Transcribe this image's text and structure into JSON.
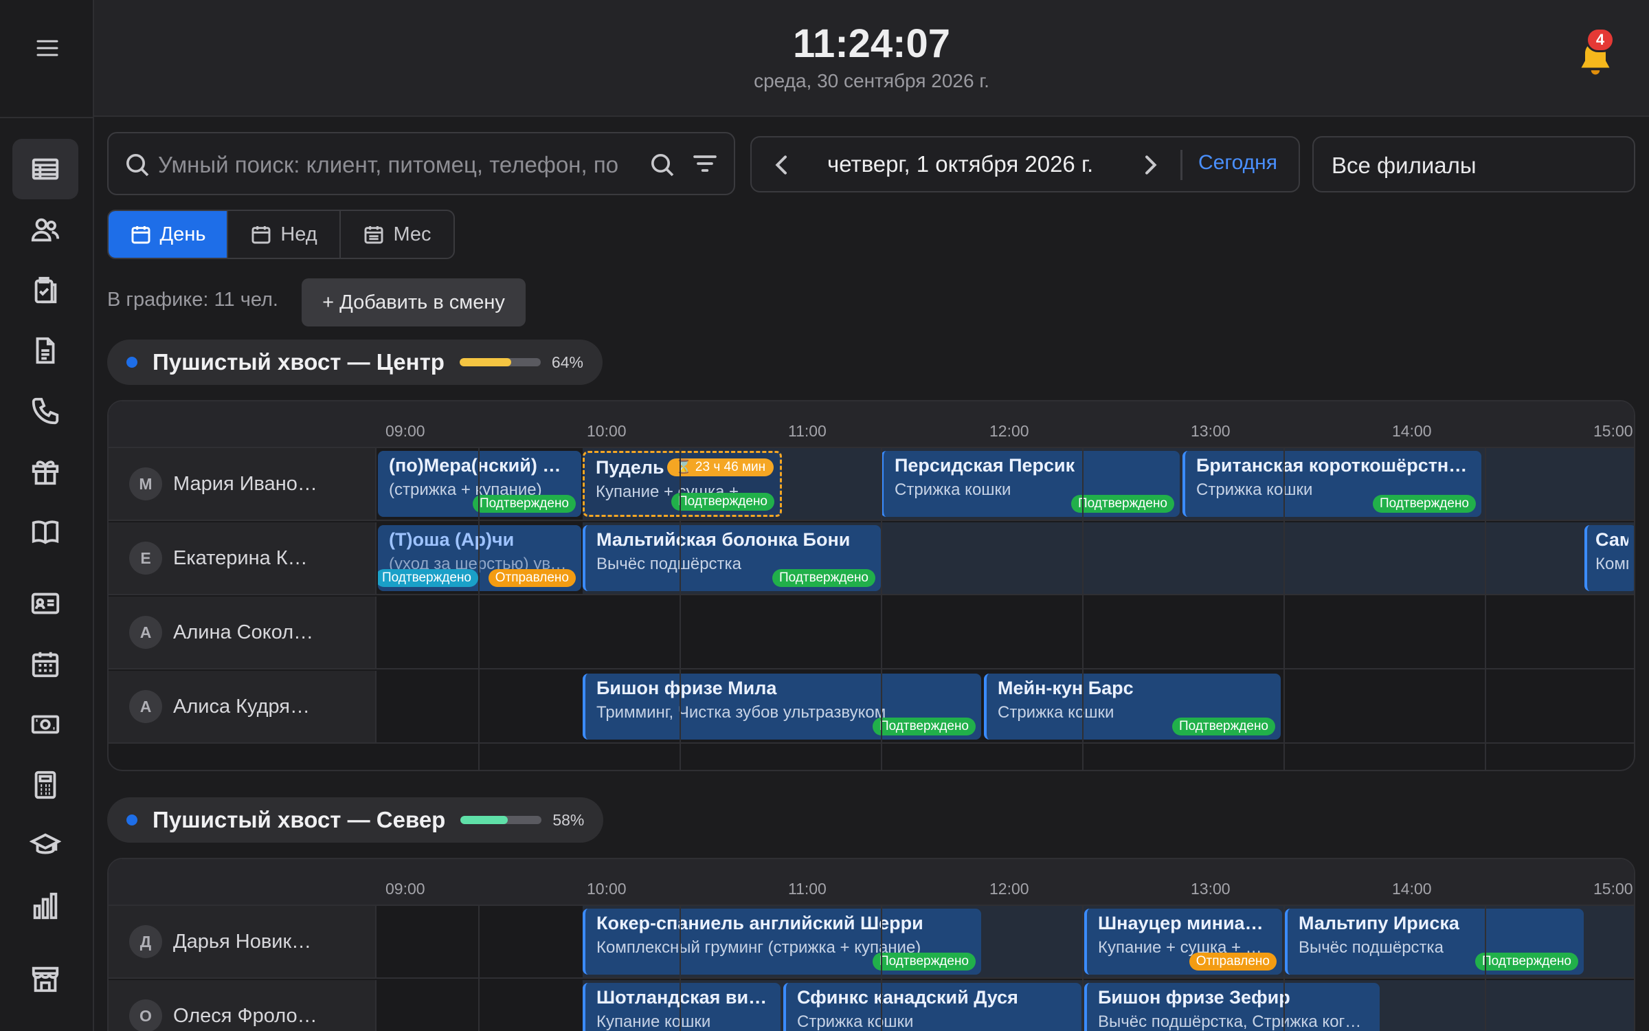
{
  "header": {
    "clock": "11:24:07",
    "date": "среда, 30 сентября 2026 г.",
    "notifications": "4"
  },
  "sidebar": {
    "icons": [
      "schedule-table-icon",
      "clients-icon",
      "clipboard-check-icon",
      "document-icon",
      "phone-icon",
      "gift-icon",
      "book-icon",
      "id-card-icon",
      "calendar-icon",
      "cash-icon",
      "calculator-icon",
      "graduation-cap-icon",
      "bar-chart-icon",
      "store-icon"
    ]
  },
  "search": {
    "placeholder": "Умный поиск: клиент, питомец, телефон, по"
  },
  "datenav": {
    "label": "четверг, 1 октября 2026 г.",
    "today": "Сегодня"
  },
  "branch_select": "Все филиалы",
  "view_tabs": [
    "День",
    "Нед",
    "Мес"
  ],
  "staff_count": "В графике: 11 чел.",
  "add_shift": "+ Добавить в смену",
  "timeline_ticks": [
    "09:00",
    "10:00",
    "11:00",
    "12:00",
    "13:00",
    "14:00",
    "15:00"
  ],
  "branches": [
    {
      "name": "Пушистый хвост — Центр",
      "load_pct": "64%",
      "load": 0.64,
      "color": "#f5c542",
      "employees": [
        {
          "initial": "М",
          "name": "Мария Ивано…"
        },
        {
          "initial": "Е",
          "name": "Екатерина К…"
        },
        {
          "initial": "А",
          "name": "Алина Сокол…"
        },
        {
          "initial": "А",
          "name": "Алиса Кудря…"
        }
      ]
    },
    {
      "name": "Пушистый хвост — Север",
      "load_pct": "58%",
      "load": 0.58,
      "color": "#5fe0a8",
      "employees": [
        {
          "initial": "Д",
          "name": "Дарья Новик…"
        },
        {
          "initial": "О",
          "name": "Олеся Фроло…"
        }
      ]
    }
  ],
  "appointments": {
    "a1": {
      "title": "(по)Мера(нский) Ла…",
      "sub": "(стрижка + купание)",
      "status": "Подтверждено"
    },
    "a2": {
      "title": "Пудель",
      "sub": "Купание + сушка + …",
      "status": "Подтверждено",
      "timer": "⌛ 23 ч 46 мин"
    },
    "a3": {
      "title": "Персидская Персик",
      "sub": "Стрижка кошки",
      "status": "Подтверждено"
    },
    "a4": {
      "title": "Британская короткошёрстн…",
      "sub": "Стрижка кошки",
      "status": "Подтверждено"
    },
    "a5": {
      "title": "(Т)оша (Ар)чи",
      "sub": "(уход за шерстью) увлаж…",
      "status": "Подтверждено",
      "status2": "Отправлено"
    },
    "a6": {
      "title": "Мальтийская болонка Бони",
      "sub": "Вычёс подшёрстка",
      "status": "Подтверждено"
    },
    "a7": {
      "title": "Сам",
      "sub": "Комп",
      "status": ""
    },
    "a8": {
      "title": "Бишон фризе Мила",
      "sub": "Тримминг, Чистка зубов ультразвуком",
      "status": "Подтверждено"
    },
    "a9": {
      "title": "Мейн-кун Барс",
      "sub": "Стрижка кошки",
      "status": "Подтверждено"
    },
    "b1": {
      "title": "Кокер-спаниель английский Шерри",
      "sub": "Комплексный груминг (стрижка + купание)",
      "status": "Подтверждено"
    },
    "b2": {
      "title": "Шнауцер миниат…",
      "sub": "Купание + сушка + …",
      "status": "Отправлено"
    },
    "b3": {
      "title": "Мальтипу Ириска",
      "sub": "Вычёс подшёрстка",
      "status": "Подтверждено"
    },
    "b4": {
      "title": "Шотландская ви…",
      "sub": "Купание кошки",
      "status": ""
    },
    "b5": {
      "title": "Сфинкс канадский Дуся",
      "sub": "Стрижка кошки",
      "status": ""
    },
    "b6": {
      "title": "Бишон фризе Зефир",
      "sub": "Вычёс подшёрстка, Стрижка ког…",
      "status": ""
    }
  }
}
